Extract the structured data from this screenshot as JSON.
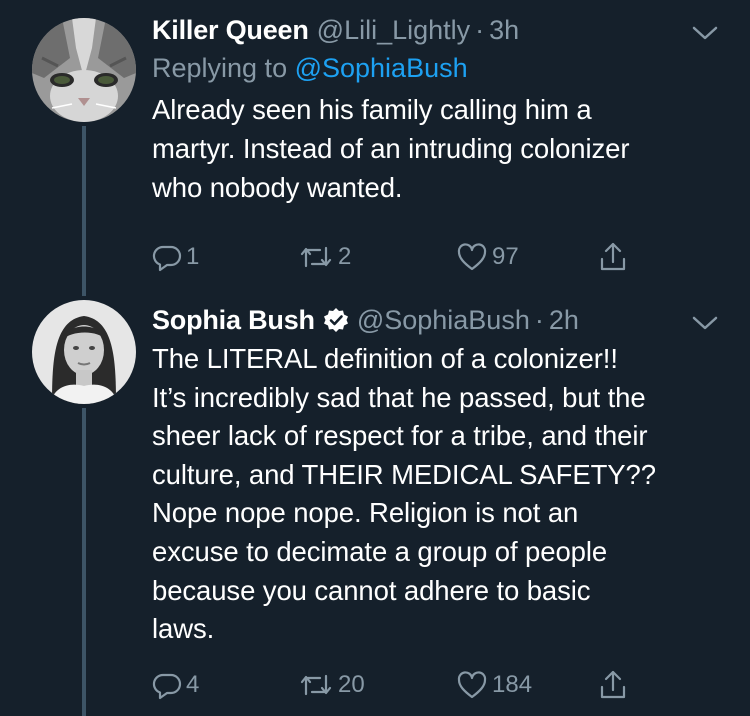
{
  "colors": {
    "background": "#15202b",
    "text": "#ffffff",
    "secondary_text": "#8899a6",
    "link": "#1da1f2",
    "thread_line": "#3d5466",
    "verified": "#ffffff"
  },
  "tweets": [
    {
      "display_name": "Killer Queen",
      "handle": "@Lili_Lightly",
      "separator": "·",
      "time": "3h",
      "verified": false,
      "avatar_icon": "cat-avatar",
      "replying_prefix": "Replying to ",
      "replying_to": "@SophiaBush",
      "body_lines": [
        "Already seen his family calling him a",
        "martyr. Instead of an intruding colonizer",
        "who nobody wanted."
      ],
      "actions": {
        "replies": "1",
        "retweets": "2",
        "likes": "97"
      }
    },
    {
      "display_name": "Sophia Bush",
      "handle": "@SophiaBush",
      "separator": "·",
      "time": "2h",
      "verified": true,
      "avatar_icon": "woman-portrait-avatar",
      "body_lines": [
        "The LITERAL definition of a colonizer!!",
        "It’s incredibly sad that he passed, but the",
        "sheer lack of respect for a tribe, and their",
        "culture, and THEIR MEDICAL SAFETY??",
        "Nope nope nope. Religion is not an",
        "excuse to decimate a group of people",
        "because you cannot adhere to basic",
        "laws."
      ],
      "actions": {
        "replies": "4",
        "retweets": "20",
        "likes": "184"
      }
    }
  ]
}
